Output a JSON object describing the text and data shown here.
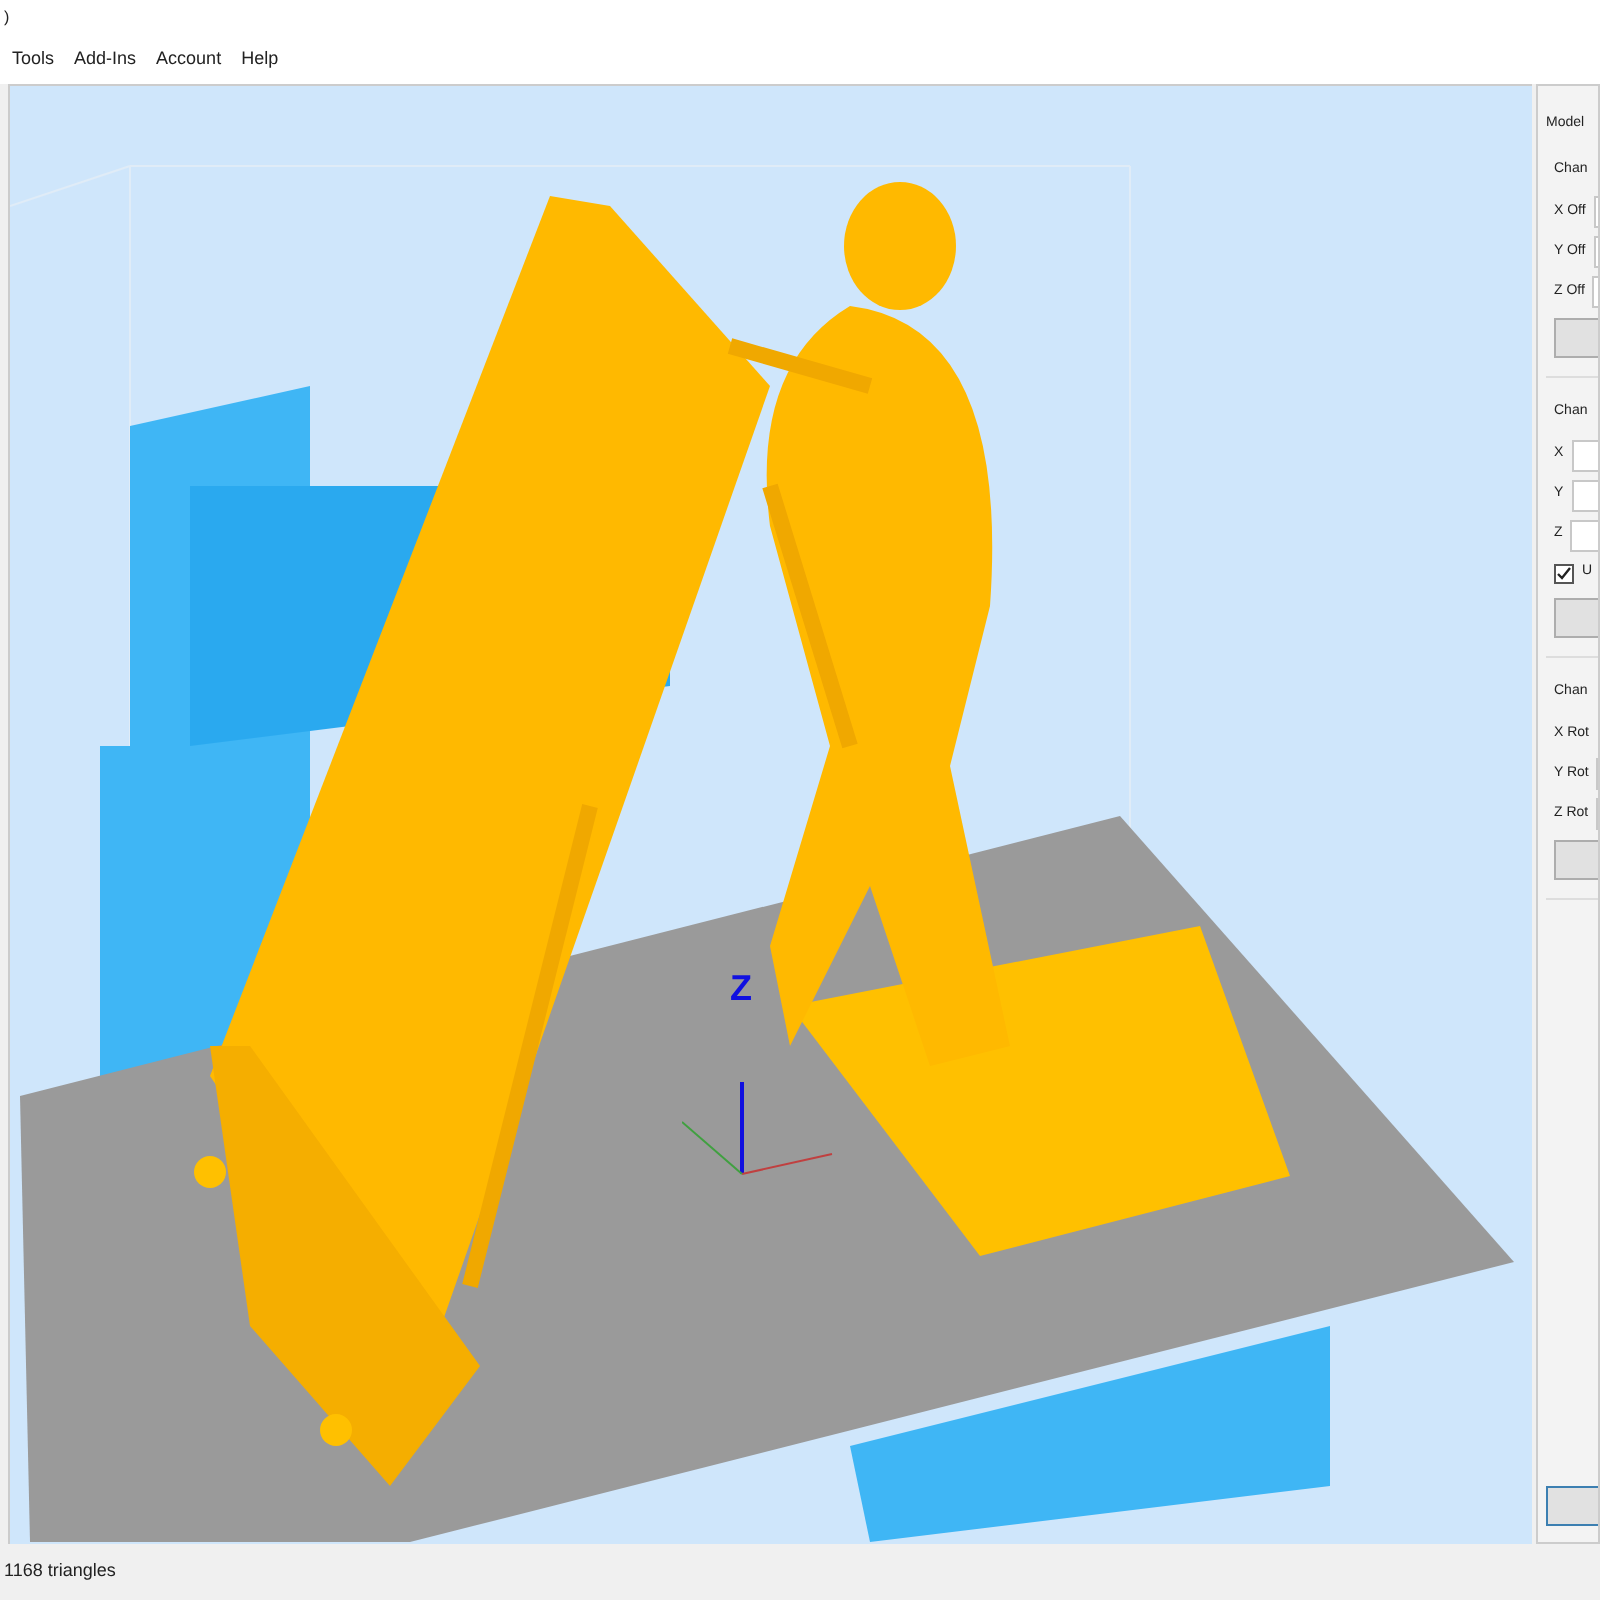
{
  "window": {
    "title": ")"
  },
  "menu": [
    "Tools",
    "Add-Ins",
    "Account",
    "Help"
  ],
  "viewport": {
    "axis_label": "Z"
  },
  "panel": {
    "title": "Model",
    "sections": [
      {
        "heading": "Chan",
        "rows": [
          {
            "kind": "field",
            "label": "X Off"
          },
          {
            "kind": "field",
            "label": "Y Off"
          },
          {
            "kind": "field",
            "label": "Z Off"
          },
          {
            "kind": "button"
          }
        ]
      },
      {
        "heading": "Chan",
        "rows": [
          {
            "kind": "field",
            "label": "X"
          },
          {
            "kind": "field",
            "label": "Y"
          },
          {
            "kind": "field",
            "label": "Z"
          },
          {
            "kind": "checkbox",
            "label": "U",
            "checked": true
          },
          {
            "kind": "button"
          }
        ]
      },
      {
        "heading": "Chan",
        "rows": [
          {
            "kind": "field",
            "label": "X Rot"
          },
          {
            "kind": "field",
            "label": "Y Rot"
          },
          {
            "kind": "field",
            "label": "Z Rot"
          },
          {
            "kind": "button"
          }
        ]
      }
    ]
  },
  "status_bar": {
    "text": "1168 triangles"
  }
}
